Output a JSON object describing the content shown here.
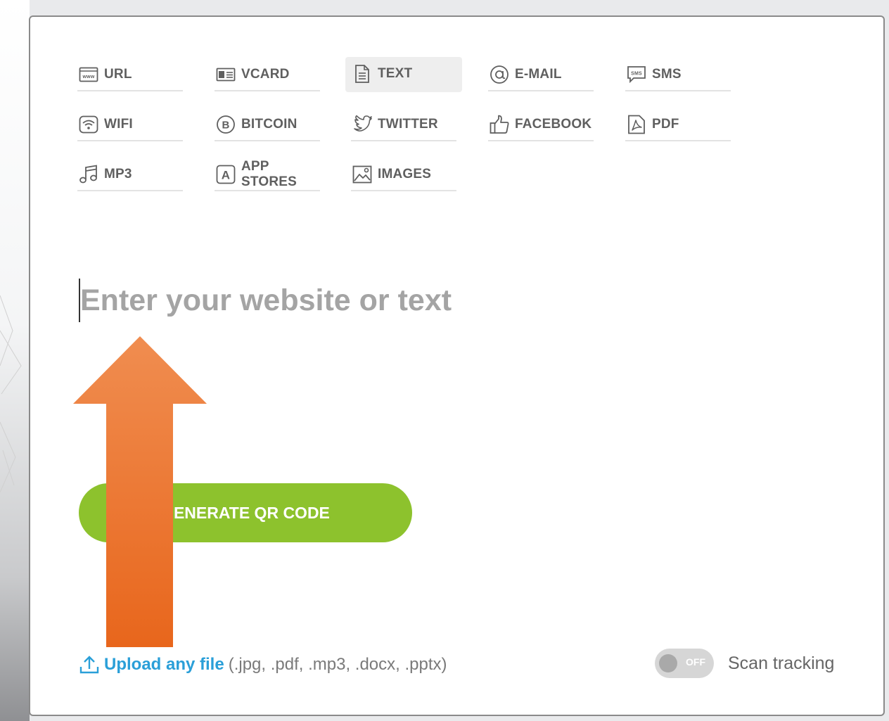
{
  "tabs": [
    {
      "label": "URL",
      "icon": "www-icon",
      "active": false
    },
    {
      "label": "VCARD",
      "icon": "vcard-icon",
      "active": false
    },
    {
      "label": "TEXT",
      "icon": "text-document-icon",
      "active": true
    },
    {
      "label": "E-MAIL",
      "icon": "at-icon",
      "active": false
    },
    {
      "label": "SMS",
      "icon": "sms-icon",
      "active": false
    },
    {
      "label": "WIFI",
      "icon": "wifi-icon",
      "active": false
    },
    {
      "label": "BITCOIN",
      "icon": "bitcoin-icon",
      "active": false
    },
    {
      "label": "TWITTER",
      "icon": "twitter-icon",
      "active": false
    },
    {
      "label": "FACEBOOK",
      "icon": "thumbs-up-icon",
      "active": false
    },
    {
      "label": "PDF",
      "icon": "pdf-icon",
      "active": false
    },
    {
      "label": "MP3",
      "icon": "music-note-icon",
      "active": false
    },
    {
      "label": "APP STORES",
      "icon": "app-store-icon",
      "active": false
    },
    {
      "label": "IMAGES",
      "icon": "image-icon",
      "active": false
    }
  ],
  "input": {
    "placeholder": "Enter your website or text",
    "value": ""
  },
  "generate_button": {
    "label": "GENERATE QR CODE"
  },
  "upload": {
    "link": "Upload any file",
    "formats": "(.jpg, .pdf, .mp3, .docx, .pptx)"
  },
  "scan_tracking": {
    "state": "OFF",
    "label": "Scan tracking"
  },
  "colors": {
    "accent_green": "#8dc22d",
    "link_blue": "#2a9fd8",
    "arrow_orange": "#ee7a2a"
  }
}
